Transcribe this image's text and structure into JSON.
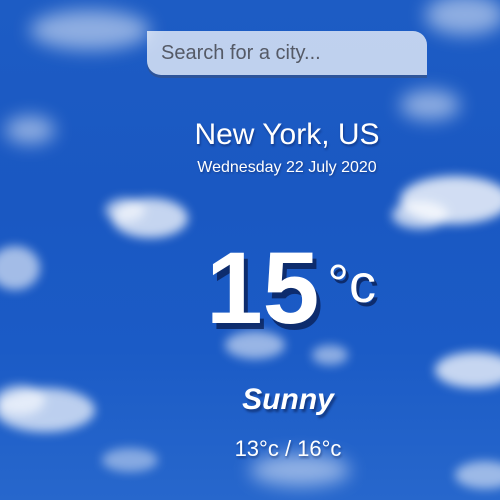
{
  "search": {
    "placeholder": "Search for a city..."
  },
  "location": {
    "city": "New York, US",
    "date": "Wednesday 22 July 2020"
  },
  "current": {
    "temperature": "15",
    "unit": "°c",
    "weather": "Sunny",
    "hi_low": "13°c / 16°c"
  },
  "colors": {
    "sky": "#1b5bc6",
    "text": "#ffffff"
  }
}
